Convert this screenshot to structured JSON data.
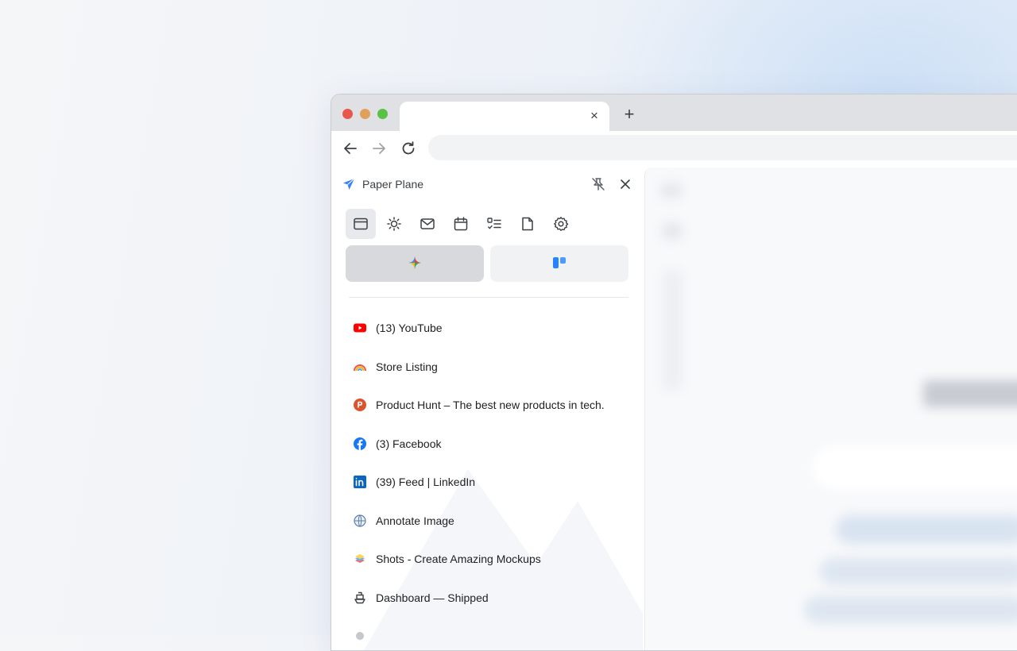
{
  "browser": {
    "tab_close_glyph": "×",
    "new_tab_glyph": "+"
  },
  "sidepanel": {
    "title": "Paper Plane",
    "accent_color": "#3b82f6",
    "toolbar_icons": [
      "tabs-icon",
      "sun-icon",
      "mail-icon",
      "calendar-icon",
      "tasks-icon",
      "note-icon",
      "settings-icon"
    ],
    "segments": [
      "ai-sparkle-icon",
      "trello-icon"
    ],
    "tabs": [
      {
        "label": "(13) YouTube",
        "icon": "youtube-icon"
      },
      {
        "label": "Store Listing",
        "icon": "rainbow-icon"
      },
      {
        "label": "Product Hunt – The best new products in tech.",
        "icon": "product-hunt-icon"
      },
      {
        "label": "(3) Facebook",
        "icon": "facebook-icon"
      },
      {
        "label": "(39) Feed | LinkedIn",
        "icon": "linkedin-icon"
      },
      {
        "label": "Annotate Image",
        "icon": "globe-icon"
      },
      {
        "label": "Shots - Create Amazing Mockups",
        "icon": "shots-icon"
      },
      {
        "label": "Dashboard — Shipped",
        "icon": "ship-icon"
      }
    ]
  }
}
